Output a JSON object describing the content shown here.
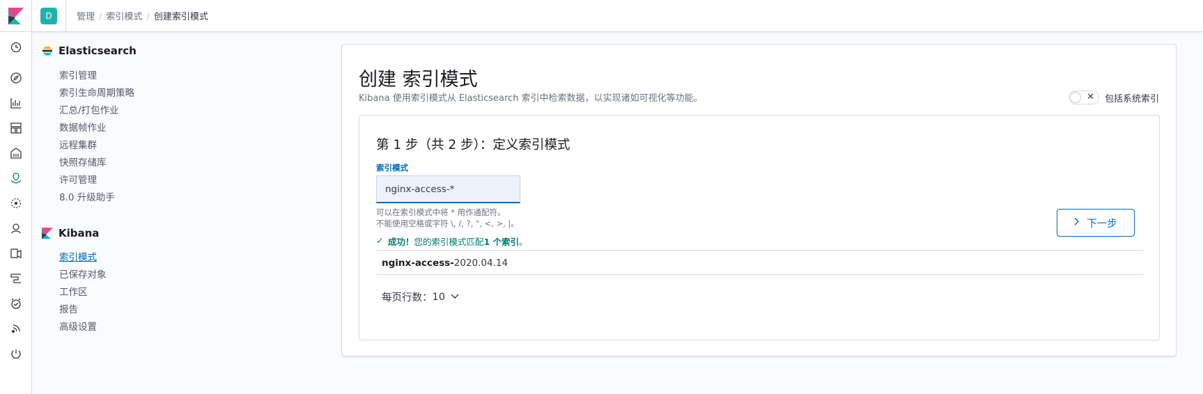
{
  "header": {
    "space_initial": "D",
    "breadcrumbs": [
      "管理",
      "索引模式",
      "创建索引模式"
    ],
    "separator": "/"
  },
  "icon_nav": [
    "clock-icon",
    "compass-icon",
    "visualize-icon",
    "dashboard-icon",
    "canvas-icon",
    "maps-icon",
    "ml-icon",
    "infra-icon",
    "logs-icon",
    "apm-icon",
    "uptime-icon",
    "siem-icon",
    "monitoring-icon"
  ],
  "sidebar": {
    "elasticsearch": {
      "title": "Elasticsearch",
      "items": [
        "索引管理",
        "索引生命周期策略",
        "汇总/打包作业",
        "数据帧作业",
        "远程集群",
        "快照存储库",
        "许可管理",
        "8.0 升级助手"
      ]
    },
    "kibana": {
      "title": "Kibana",
      "items": [
        "索引模式",
        "已保存对象",
        "工作区",
        "报告",
        "高级设置"
      ],
      "active_index": 0
    }
  },
  "main": {
    "title": "创建 索引模式",
    "subtitle": "Kibana 使用索引模式从 Elasticsearch 索引中检索数据，以实现诸如可视化等功能。",
    "toggle_label": "包括系统索引",
    "toggle_on": false,
    "step_title": "第 1 步（共 2 步）：定义索引模式",
    "field_label": "索引模式",
    "field_value": "nginx-access-*",
    "help_line_1": "可以在索引模式中将 * 用作通配符。",
    "help_line_2": "不能使用空格或字符 \\, /, ?, \", <, >, |。",
    "success_prefix": "成功！",
    "success_middle": "您的索引模式匹配 ",
    "success_count": "1 个索引",
    "success_suffix": "。",
    "match_bold": "nginx-access-",
    "match_rest": "2020.04.14",
    "rows_per_page_label": "每页行数：",
    "rows_per_page_value": "10",
    "next_button": "下一步"
  },
  "colors": {
    "accent": "#006bb4",
    "success": "#017d73",
    "space_badge": "#20b2aa"
  }
}
